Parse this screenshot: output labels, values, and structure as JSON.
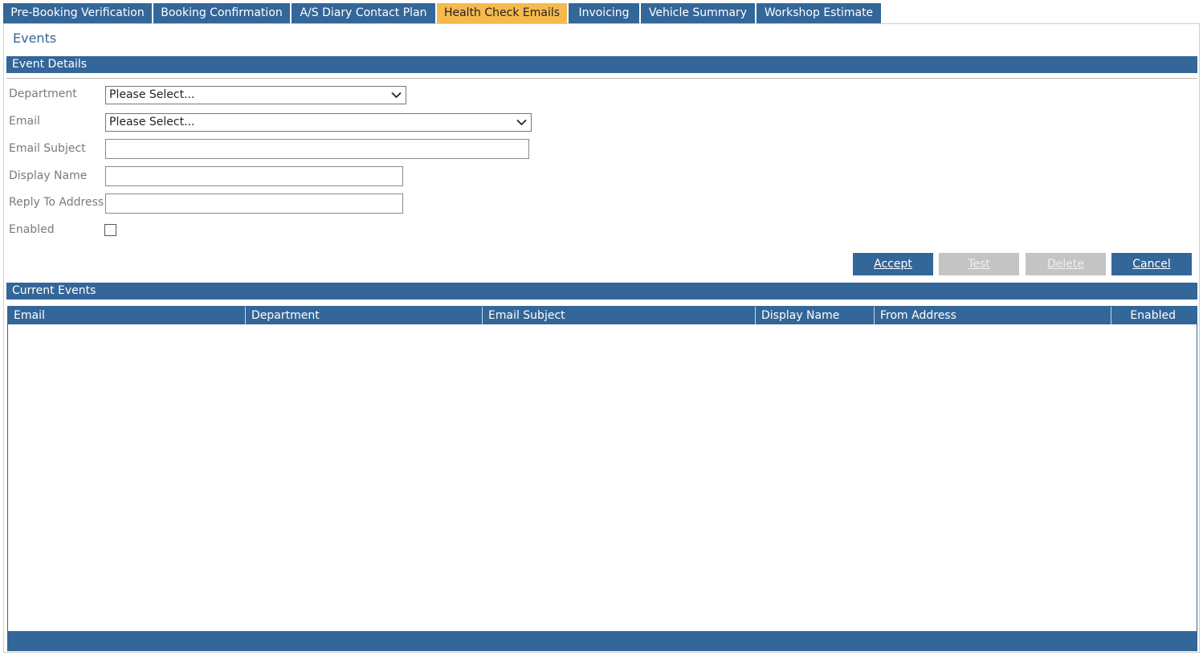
{
  "tabs": [
    {
      "label": "Pre-Booking Verification",
      "active": false
    },
    {
      "label": "Booking Confirmation",
      "active": false
    },
    {
      "label": "A/S Diary Contact Plan",
      "active": false
    },
    {
      "label": "Health Check Emails",
      "active": true
    },
    {
      "label": "Invoicing",
      "active": false
    },
    {
      "label": "Vehicle Summary",
      "active": false
    },
    {
      "label": "Workshop Estimate",
      "active": false
    }
  ],
  "page_title": "Events",
  "event_details": {
    "header": "Event Details",
    "fields": {
      "department": {
        "label": "Department",
        "value": "Please Select..."
      },
      "email": {
        "label": "Email",
        "value": "Please Select..."
      },
      "email_subject": {
        "label": "Email Subject",
        "value": ""
      },
      "display_name": {
        "label": "Display Name",
        "value": ""
      },
      "reply_to": {
        "label": "Reply To Address",
        "value": ""
      },
      "enabled": {
        "label": "Enabled",
        "checked": false
      }
    },
    "buttons": {
      "accept": {
        "label": "Accept",
        "enabled": true
      },
      "test": {
        "label": "Test",
        "enabled": false
      },
      "delete": {
        "label": "Delete",
        "enabled": false
      },
      "cancel": {
        "label": "Cancel",
        "enabled": true
      }
    }
  },
  "current_events": {
    "header": "Current Events",
    "columns": [
      "Email",
      "Department",
      "Email Subject",
      "Display Name",
      "From Address",
      "Enabled"
    ],
    "rows": []
  },
  "colors": {
    "primary": "#336699",
    "active_tab": "#f5b94e",
    "disabled_button": "#c4c4c4"
  },
  "icons": {
    "dropdown": "chevron-down-icon"
  }
}
